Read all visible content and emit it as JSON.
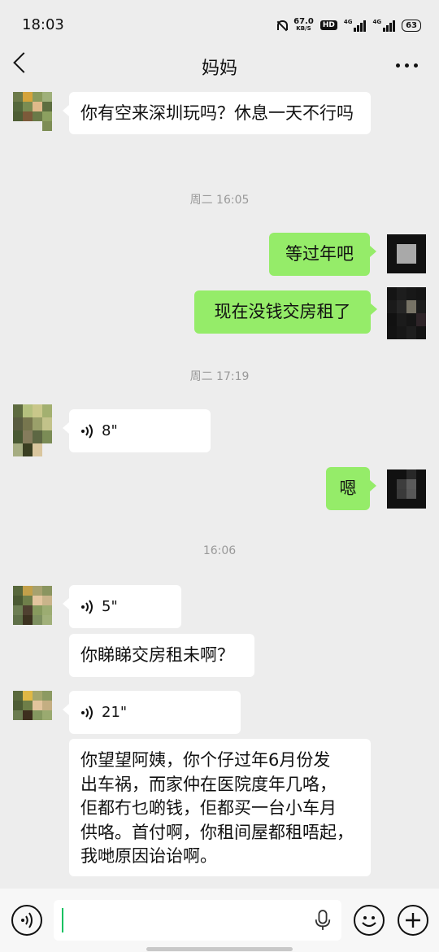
{
  "status_bar": {
    "time": "18:03",
    "net_speed": "67.0",
    "net_unit": "KB/S",
    "hd_badge": "HD",
    "signal_1": "4G",
    "signal_2": "4G",
    "battery": "63"
  },
  "header": {
    "title": "妈妈"
  },
  "messages": [
    {
      "side": "in",
      "text": "你有空来深圳玩吗？休息一天不行吗"
    },
    {
      "type": "timestamp",
      "text": "周二 16:05"
    },
    {
      "side": "out",
      "text": "等过年吧"
    },
    {
      "side": "out",
      "text": "现在没钱交房租了"
    },
    {
      "type": "timestamp",
      "text": "周二 17:19"
    },
    {
      "side": "in",
      "type": "voice",
      "duration": "8\""
    },
    {
      "side": "out",
      "text": "嗯"
    },
    {
      "type": "timestamp",
      "text": "16:06"
    },
    {
      "side": "in",
      "type": "voice",
      "duration": "5\""
    },
    {
      "side": "in",
      "text": "你睇睇交房租未啊？"
    },
    {
      "side": "in",
      "type": "voice",
      "duration": "21\""
    },
    {
      "side": "in",
      "text_lines": [
        "你望望阿姨，你个仔过年6月份发",
        "出车祸，而家仲在医院度年几咯，",
        "佢都冇乜啲钱，佢都买一台小车月",
        "供咯。首付啊，你租间屋都租唔起，",
        "我哋原因诒诒啊。"
      ]
    }
  ],
  "input": {
    "value": ""
  },
  "icons": [
    "back-arrow-icon",
    "more-icon",
    "voice-mode-icon",
    "microphone-icon",
    "emoji-icon",
    "plus-icon"
  ],
  "colors": {
    "background": "#ededed",
    "incoming_bubble": "#ffffff",
    "outgoing_bubble": "#95ec69",
    "caret": "#07c160"
  }
}
